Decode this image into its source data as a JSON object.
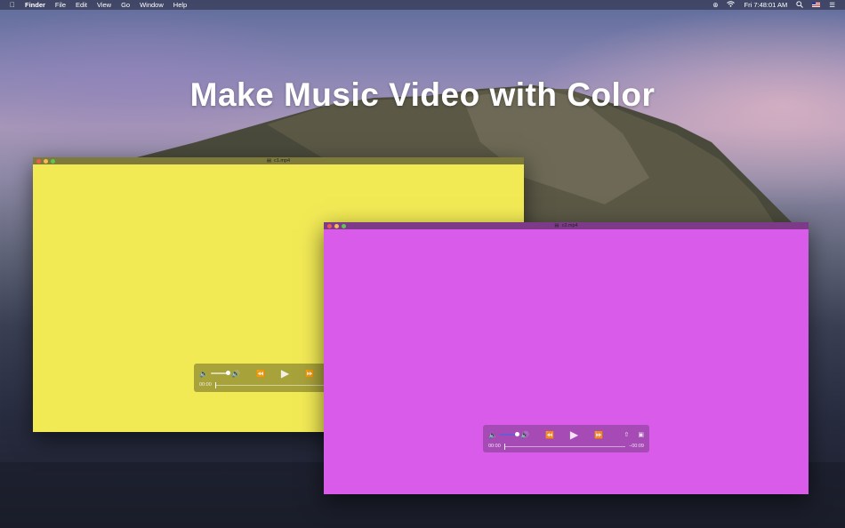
{
  "menubar": {
    "apple": "",
    "items": [
      "Finder",
      "File",
      "Edit",
      "View",
      "Go",
      "Window",
      "Help"
    ],
    "clock": "Fri 7:48:01 AM",
    "icons": [
      "bluetooth-icon",
      "wifi-icon",
      "search-icon",
      "flag-icon",
      "list-icon"
    ]
  },
  "headline": "Make Music Video with Color",
  "window1": {
    "title": "c1.mp4",
    "color": "#f2ea55",
    "controls": {
      "time_elapsed": "00:00"
    }
  },
  "window2": {
    "title": "c2.mp4",
    "color": "#d95bea",
    "controls": {
      "time_elapsed": "00:00",
      "time_remaining": "−00:09"
    }
  },
  "colors": {
    "yellow": "#f2ea55",
    "magenta": "#d95bea"
  }
}
